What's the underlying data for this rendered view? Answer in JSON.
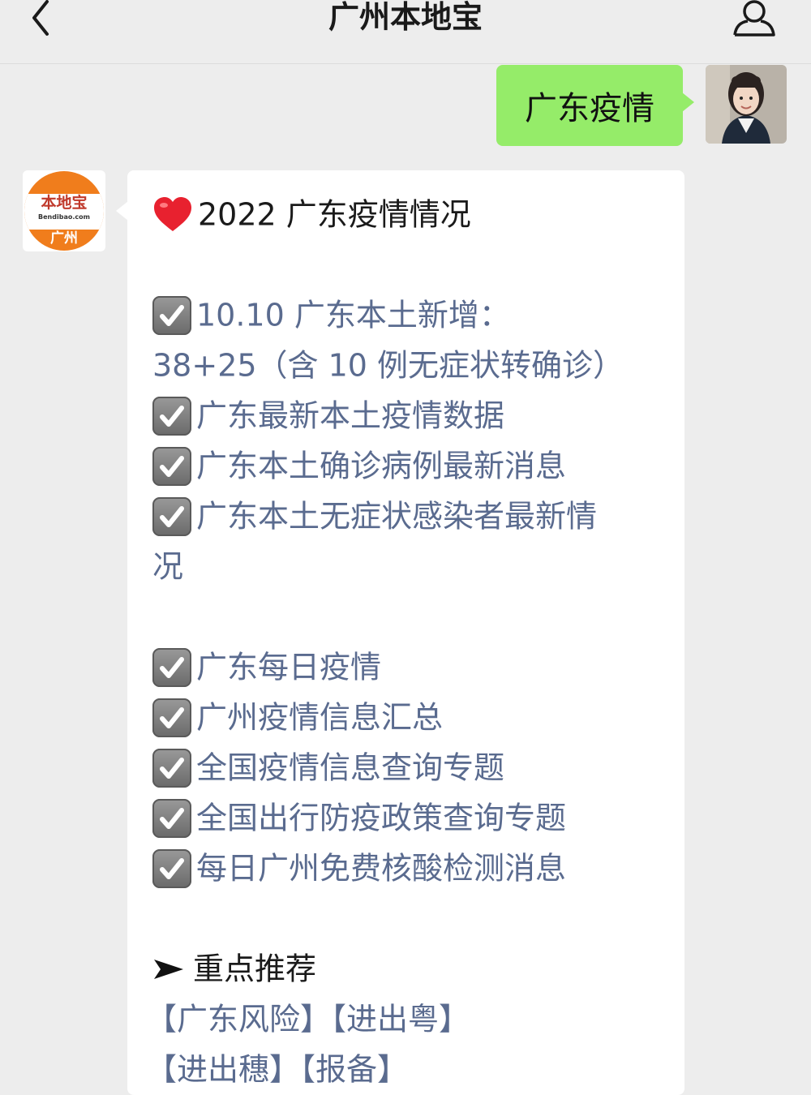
{
  "header": {
    "title": "广州本地宝",
    "back_icon": "chevron-left-icon",
    "user_icon": "user-icon"
  },
  "outgoing_message": {
    "text": "广东疫情",
    "bubble_color": "#95ec69"
  },
  "incoming_message": {
    "avatar": {
      "logo_main": "本地宝",
      "logo_url": "Bendibao.com",
      "logo_city": "广州",
      "brand_color": "#f07d1c"
    },
    "heading": "2022 广东疫情情况",
    "checklist_1": [
      "10.10 广东本土新增：",
      "广东最新本土疫情数据",
      "广东本土确诊病例最新消息",
      "广东本土无症状感染者最新情"
    ],
    "update_line": "38+25（含 10 例无症状转确诊）",
    "wrap_text": "况",
    "checklist_2": [
      "广东每日疫情",
      "广州疫情信息汇总",
      "全国疫情信息查询专题",
      "全国出行防疫政策查询专题",
      "每日广州免费核酸检测消息"
    ],
    "recommend_title": "重点推荐",
    "recommend_line_1": "【广东风险】【进出粤】",
    "recommend_line_2": "【进出穗】【报备】",
    "link_color": "#5a6b8f"
  }
}
